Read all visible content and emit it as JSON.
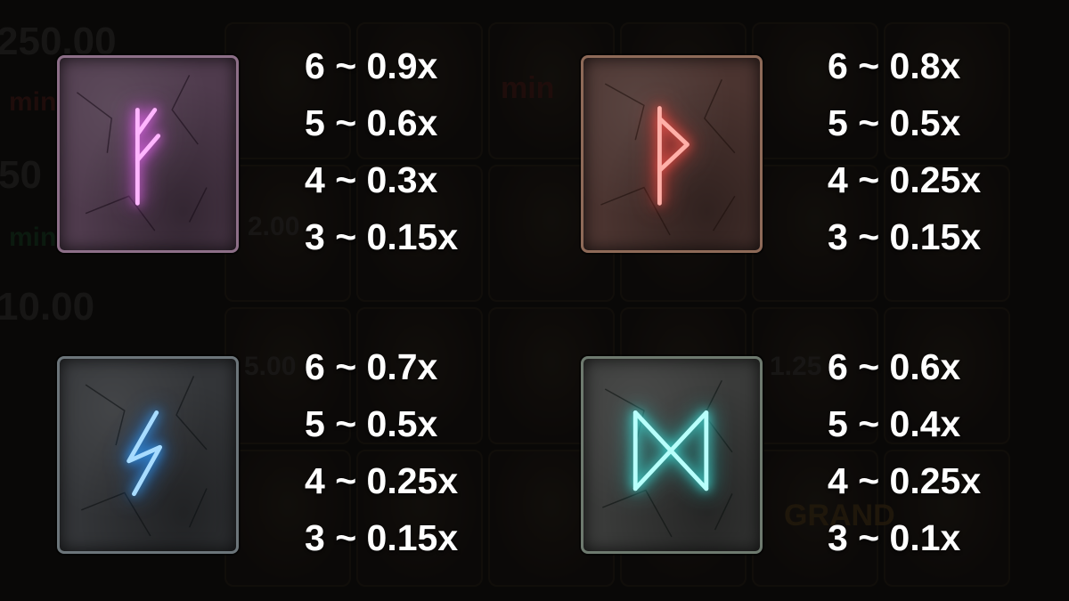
{
  "background": {
    "values": [
      "250.00",
      "min",
      "50",
      "min",
      "10.00",
      "2.00",
      "5.00",
      "1.25",
      "min",
      "GRAND"
    ]
  },
  "symbols": [
    {
      "icon": "fehu-rune-icon",
      "color": "#e86bf0",
      "pays": [
        "6 ~ 0.9x",
        "5 ~ 0.6x",
        "4 ~ 0.3x",
        "3 ~ 0.15x"
      ]
    },
    {
      "icon": "thurisaz-rune-icon",
      "color": "#ff5a52",
      "pays": [
        "6 ~ 0.8x",
        "5 ~ 0.5x",
        "4 ~ 0.25x",
        "3 ~ 0.15x"
      ]
    },
    {
      "icon": "sowilo-rune-icon",
      "color": "#3aa8ff",
      "pays": [
        "6 ~ 0.7x",
        "5 ~ 0.5x",
        "4 ~ 0.25x",
        "3 ~ 0.15x"
      ]
    },
    {
      "icon": "dagaz-rune-icon",
      "color": "#49e6e0",
      "pays": [
        "6 ~ 0.6x",
        "5 ~ 0.4x",
        "4 ~ 0.25x",
        "3 ~ 0.1x"
      ]
    }
  ]
}
